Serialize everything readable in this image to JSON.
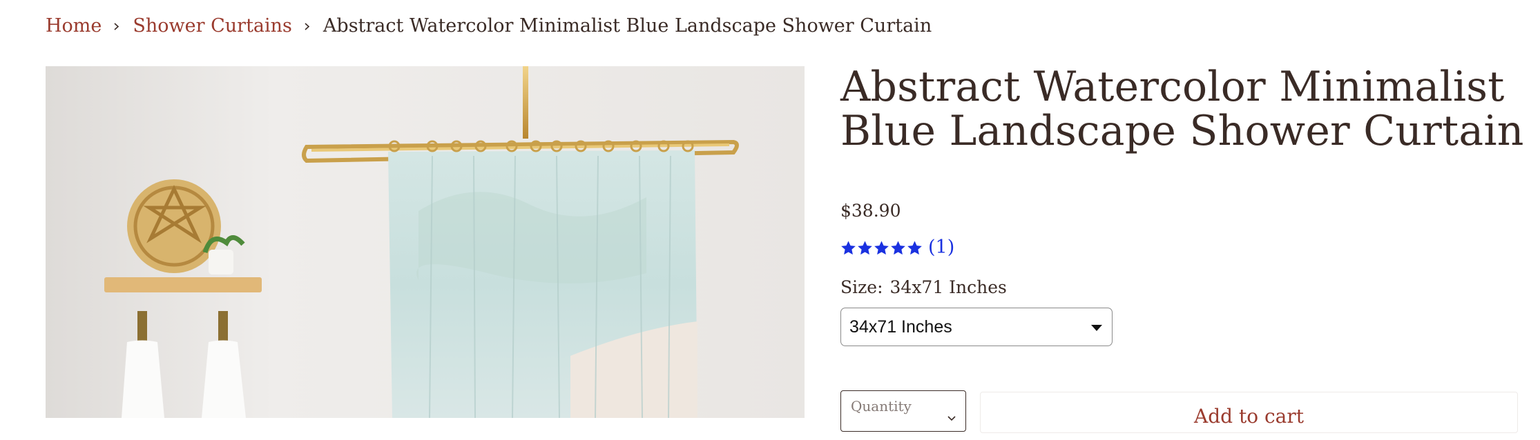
{
  "breadcrumb": {
    "home": "Home",
    "category": "Shower Curtains",
    "current": "Abstract Watercolor Minimalist Blue Landscape Shower Curtain"
  },
  "product": {
    "title": "Abstract Watercolor Minimalist Blue Landscape Shower Curtain",
    "price": "$38.90",
    "rating_stars": 5,
    "review_count": "(1)",
    "size_label": "Size:",
    "size_value": "34x71 Inches",
    "size_options_selected": "34x71 Inches",
    "quantity_label": "Quantity",
    "add_to_cart": "Add to cart"
  },
  "colors": {
    "link": "#9a3b2e",
    "text": "#3a2b26",
    "rating": "#1a31e0"
  },
  "icons": {
    "breadcrumb_separator": "chevron-right-icon",
    "select_caret": "caret-down-icon",
    "quantity_chevron": "chevron-down-icon",
    "star": "star-icon"
  }
}
